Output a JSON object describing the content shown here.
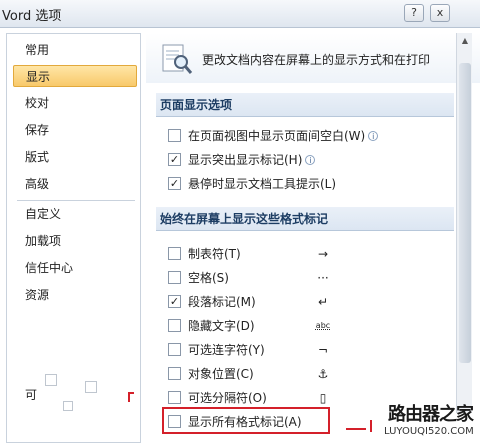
{
  "window": {
    "title": "Vord 选项",
    "help_label": "?",
    "close_label": "x"
  },
  "nav": {
    "items": [
      "常用",
      "显示",
      "校对",
      "保存",
      "版式",
      "高级",
      "自定义",
      "加载项",
      "信任中心",
      "资源"
    ],
    "selected": "显示",
    "partial_label": "可"
  },
  "main": {
    "header_text": "更改文档内容在屏幕上的显示方式和在打印",
    "section1": {
      "title": "页面显示选项",
      "options": [
        {
          "label": "在页面视图中显示页面间空白(W)",
          "checked": false,
          "info": true
        },
        {
          "label": "显示突出显示标记(H)",
          "checked": true,
          "info": true
        },
        {
          "label": "悬停时显示文档工具提示(L)",
          "checked": true,
          "info": false
        }
      ]
    },
    "section2": {
      "title": "始终在屏幕上显示这些格式标记",
      "options": [
        {
          "label": "制表符(T)",
          "checked": false,
          "mark": "→"
        },
        {
          "label": "空格(S)",
          "checked": false,
          "mark": "···"
        },
        {
          "label": "段落标记(M)",
          "checked": true,
          "mark": "↵"
        },
        {
          "label": "隐藏文字(D)",
          "checked": false,
          "mark": "abc"
        },
        {
          "label": "可选连字符(Y)",
          "checked": false,
          "mark": "¬"
        },
        {
          "label": "对象位置(C)",
          "checked": false,
          "mark": "⚓"
        },
        {
          "label": "可选分隔符(O)",
          "checked": false,
          "mark": "▯"
        },
        {
          "label": "显示所有格式标记(A)",
          "checked": false,
          "mark": ""
        }
      ]
    }
  },
  "watermark": {
    "text": "路由器之家",
    "url": "LUYOUQI520.COM"
  },
  "colors": {
    "selected_nav": "#f8c96a",
    "highlight_box": "#d4202a",
    "section_title": "#1d3d63"
  }
}
